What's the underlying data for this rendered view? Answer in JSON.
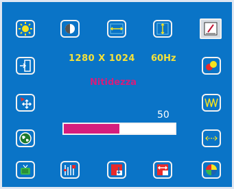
{
  "osd": {
    "resolution": "1280 X 1024",
    "refresh_rate": "60Hz",
    "menu_title": "Nitidezza",
    "sharpness_value": "50",
    "sharpness_level": 0.5,
    "colors": {
      "background": "#0a74c7",
      "accent": "#d51d7d",
      "info_text": "#f5e13a"
    }
  },
  "icons": {
    "left": [
      "brightness-icon",
      "exit-icon",
      "position-icon",
      "language-icon"
    ],
    "top": [
      "contrast-icon",
      "h-position-icon",
      "v-position-icon",
      "sharpness-icon"
    ],
    "right": [
      "color-icon",
      "clock-icon",
      "phase-icon"
    ],
    "bottom": [
      "tv-icon",
      "tools-icon",
      "reset-icon",
      "recall-icon",
      "color-temp-icon"
    ]
  }
}
